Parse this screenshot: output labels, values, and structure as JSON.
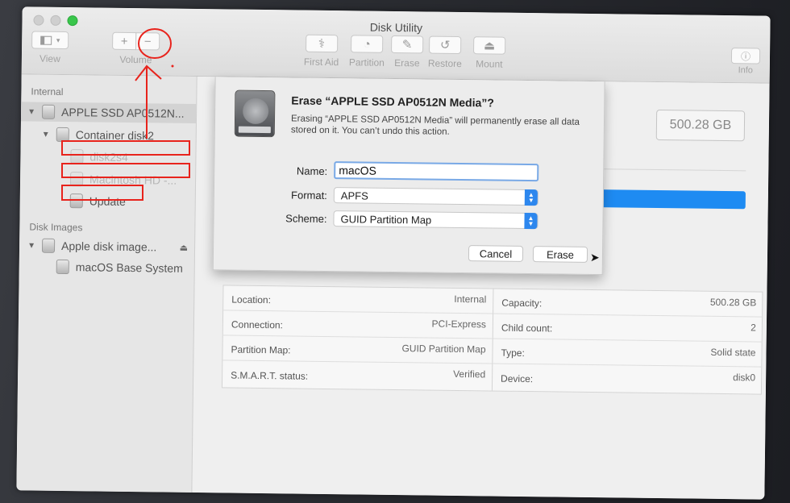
{
  "window": {
    "title": "Disk Utility"
  },
  "toolbar": {
    "view_label": "View",
    "volume_label": "Volume",
    "volume_add": "+",
    "volume_remove": "−",
    "first_aid_label": "First Aid",
    "partition_label": "Partition",
    "erase_label": "Erase",
    "restore_label": "Restore",
    "mount_label": "Mount",
    "info_label": "Info"
  },
  "sidebar": {
    "internal_header": "Internal",
    "disk_images_header": "Disk Images",
    "items": [
      {
        "label": "APPLE SSD AP0512N..."
      },
      {
        "label": "Container disk2"
      },
      {
        "label": "disk2s4"
      },
      {
        "label": "Macintosh HD -..."
      },
      {
        "label": "Update"
      },
      {
        "label": "Apple disk image..."
      },
      {
        "label": "macOS Base System"
      }
    ]
  },
  "main": {
    "capacity_box": "500.28 GB",
    "info": {
      "location_key": "Location:",
      "location_val": "Internal",
      "connection_key": "Connection:",
      "connection_val": "PCI-Express",
      "partition_map_key": "Partition Map:",
      "partition_map_val": "GUID Partition Map",
      "smart_key": "S.M.A.R.T. status:",
      "smart_val": "Verified",
      "capacity_key": "Capacity:",
      "capacity_val": "500.28 GB",
      "child_count_key": "Child count:",
      "child_count_val": "2",
      "type_key": "Type:",
      "type_val": "Solid state",
      "device_key": "Device:",
      "device_val": "disk0"
    }
  },
  "dialog": {
    "title": "Erase “APPLE SSD AP0512N Media”?",
    "message": "Erasing “APPLE SSD AP0512N Media” will permanently erase all data stored on it. You can’t undo this action.",
    "name_label": "Name:",
    "name_value": "macOS",
    "format_label": "Format:",
    "format_value": "APFS",
    "scheme_label": "Scheme:",
    "scheme_value": "GUID Partition Map",
    "cancel_label": "Cancel",
    "erase_label": "Erase"
  },
  "colors": {
    "accent": "#1e8bf2",
    "annotation": "#e8231c"
  }
}
